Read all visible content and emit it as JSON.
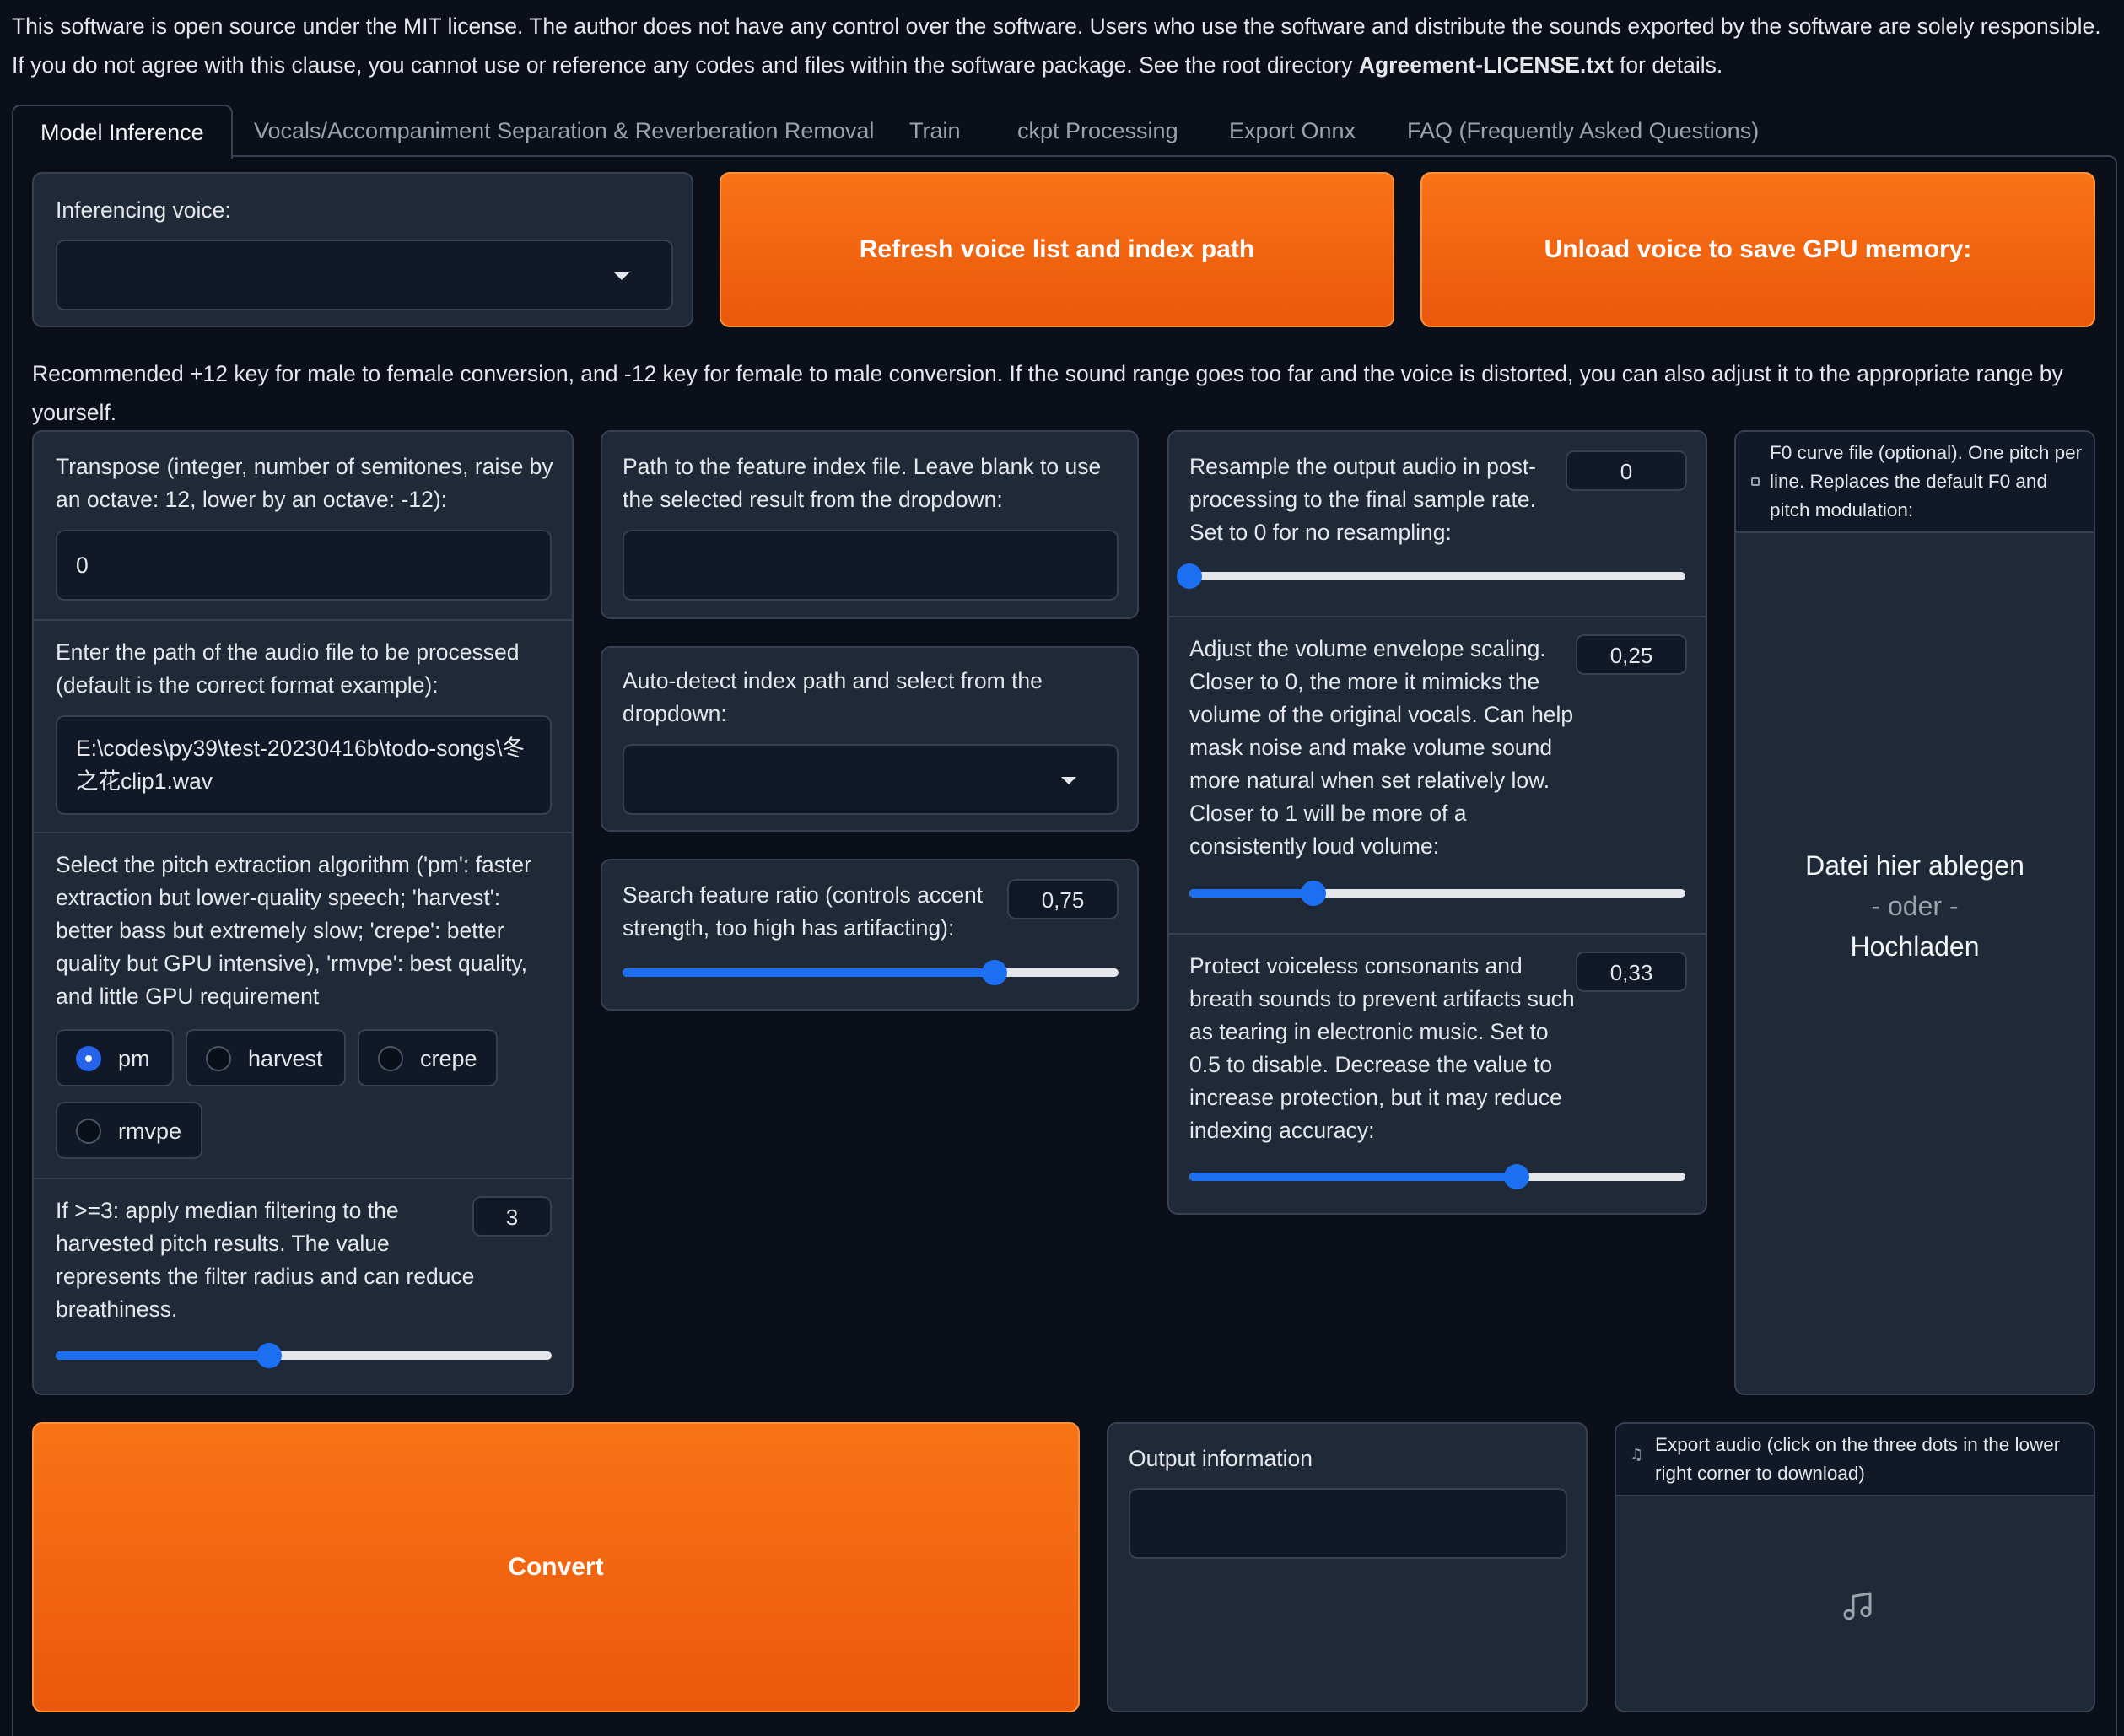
{
  "notice": {
    "line1": "This software is open source under the MIT license. The author does not have any control over the software. Users who use the software and distribute the sounds exported by the software are solely responsible.",
    "line2_prefix": "If you do not agree with this clause, you cannot use or reference any codes and files within the software package. See the root directory ",
    "line2_bold": "Agreement-LICENSE.txt",
    "line2_suffix": " for details."
  },
  "tabs": [
    {
      "label": "Model Inference",
      "active": true
    },
    {
      "label": "Vocals/Accompaniment Separation & Reverberation Removal"
    },
    {
      "label": "Train"
    },
    {
      "label": "ckpt Processing"
    },
    {
      "label": "Export Onnx"
    },
    {
      "label": "FAQ (Frequently Asked Questions)"
    }
  ],
  "voice": {
    "label": "Inferencing voice:",
    "value": "",
    "refresh_button": "Refresh voice list and index path",
    "unload_button": "Unload voice to save GPU memory:"
  },
  "recommend_text": "Recommended +12 key for male to female conversion, and -12 key for female to male conversion. If the sound range goes too far and the voice is distorted, you can also adjust it to the appropriate range by yourself.",
  "transpose": {
    "label": "Transpose (integer, number of semitones, raise by an octave: 12, lower by an octave: -12):",
    "value": "0"
  },
  "audio_path": {
    "label": "Enter the path of the audio file to be processed (default is the correct format example):",
    "value_line1": "E:\\codes\\py39\\test-20230416b\\todo-songs\\冬",
    "value_line2": "之花clip1.wav"
  },
  "pitch_algo": {
    "label": "Select the pitch extraction algorithm ('pm': faster extraction but lower-quality speech; 'harvest': better bass but extremely slow; 'crepe': better quality but GPU intensive), 'rmvpe': best quality, and little GPU requirement",
    "options": [
      "pm",
      "harvest",
      "crepe",
      "rmvpe"
    ],
    "selected": "pm"
  },
  "median_filter": {
    "label": "If >=3: apply median filtering to the harvested pitch results. The value represents the filter radius and can reduce breathiness.",
    "value": "3",
    "fraction": 0.43
  },
  "index_path": {
    "label": "Path to the feature index file. Leave blank to use the selected result from the dropdown:",
    "value": ""
  },
  "auto_index": {
    "label": "Auto-detect index path and select from the dropdown:",
    "value": ""
  },
  "search_ratio": {
    "label": "Search feature ratio (controls accent strength, too high has artifacting):",
    "value": "0,75",
    "fraction": 0.75
  },
  "resample": {
    "label": "Resample the output audio in post-processing to the final sample rate. Set to 0 for no resampling:",
    "value": "0",
    "fraction": 0.0
  },
  "volume_env": {
    "label": "Adjust the volume envelope scaling. Closer to 0, the more it mimicks the volume of the original vocals. Can help mask noise and make volume sound more natural when set relatively low. Closer to 1 will be more of a consistently loud volume:",
    "value": "0,25",
    "fraction": 0.25
  },
  "protect": {
    "label": "Protect voiceless consonants and breath sounds to prevent artifacts such as tearing in electronic music. Set to 0.5 to disable. Decrease the value to increase protection, but it may reduce indexing accuracy:",
    "value": "0,33",
    "fraction": 0.66
  },
  "f0_file": {
    "label": "F0 curve file (optional). One pitch per line. Replaces the default F0 and pitch modulation:",
    "drop_line1": "Datei hier ablegen",
    "drop_line2": "- oder -",
    "drop_line3": "Hochladen",
    "icon": "file-icon"
  },
  "convert_button": "Convert",
  "output_info": {
    "label": "Output information",
    "value": ""
  },
  "export_audio": {
    "label": "Export audio (click on the three dots in the lower right corner to download)",
    "icon": "music-note-icon"
  },
  "colors": {
    "accent_orange": "#f97316",
    "slider_blue": "#1d6ff2",
    "panel_bg": "#1f2937",
    "page_bg": "#0b0f19"
  }
}
